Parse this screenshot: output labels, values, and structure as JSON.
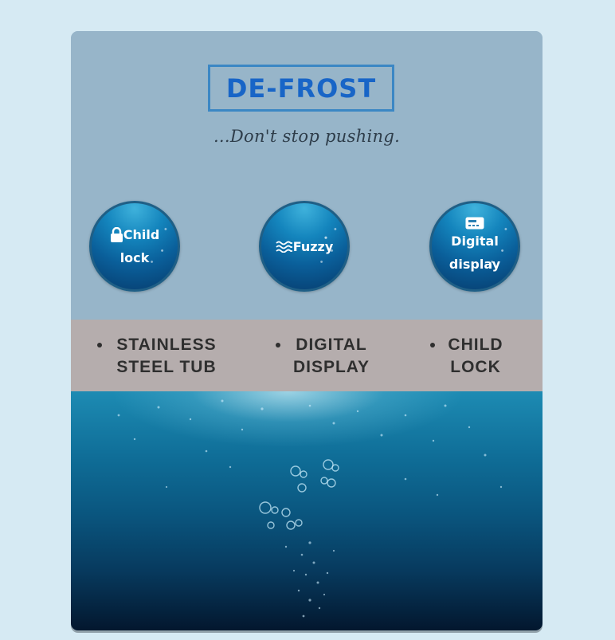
{
  "brand": {
    "title": "DE-FROST",
    "tagline": "...Don't stop pushing."
  },
  "colors": {
    "page_background": "#d6eaf3",
    "card_background": "#97b5c9",
    "brand_blue": "#1865c7",
    "brand_border": "#3b87c4",
    "features_band": "#b5adad",
    "feature_text": "#2f2f2f"
  },
  "bubbles": [
    {
      "icon": "lock-icon",
      "label_line1": "Child",
      "label_line2": "lock"
    },
    {
      "icon": "waves-icon",
      "label_line1": "Fuzzy"
    },
    {
      "icon": "display-card-icon",
      "label_line1": "Digital",
      "label_line2": "display"
    }
  ],
  "features": [
    {
      "line1": "STAINLESS",
      "line2": "STEEL TUB"
    },
    {
      "line1": "DIGITAL",
      "line2": "DISPLAY"
    },
    {
      "line1": "CHILD",
      "line2": "LOCK"
    }
  ],
  "hero_image": {
    "subject": "underwater-bubbles-image"
  }
}
